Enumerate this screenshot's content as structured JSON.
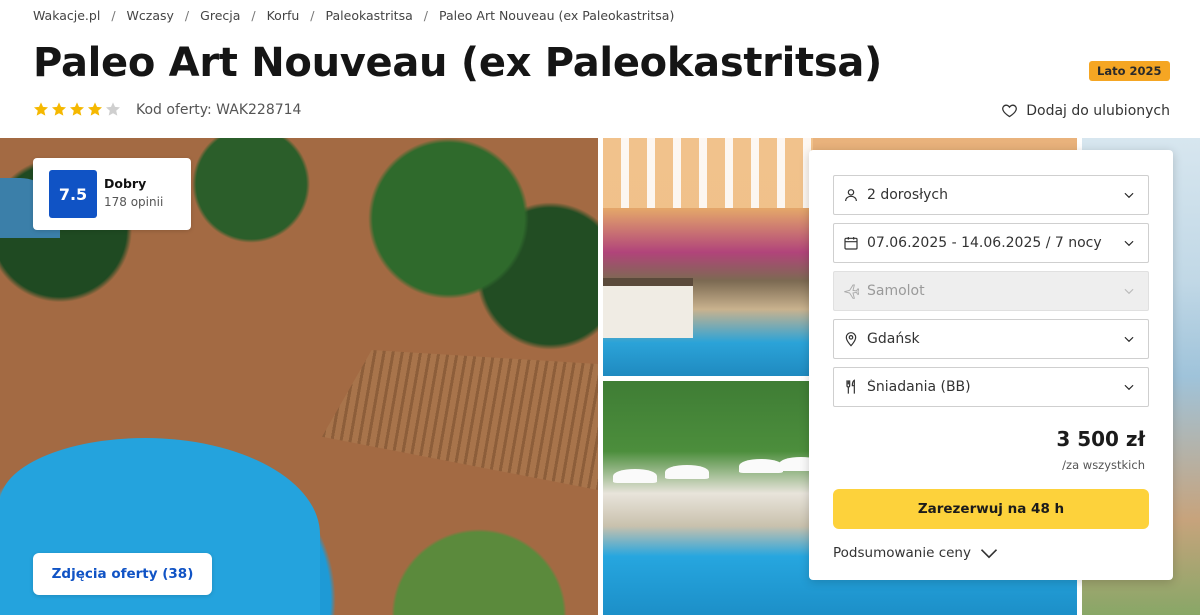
{
  "breadcrumb": [
    "Wakacje.pl",
    "Wczasy",
    "Grecja",
    "Korfu",
    "Paleokastritsa",
    "Paleo Art Nouveau (ex Paleokastritsa)"
  ],
  "title": "Paleo Art Nouveau (ex Paleokastritsa)",
  "season_badge": "Lato 2025",
  "stars": {
    "filled": 4,
    "total": 5
  },
  "offer_code": "Kod oferty: WAK228714",
  "favorite_label": "Dodaj do ulubionych",
  "rating": {
    "score": "7.5",
    "word": "Dobry",
    "count": "178 opinii"
  },
  "photos_button": "Zdjęcia oferty (38)",
  "booking": {
    "guests": "2 dorosłych",
    "dates": "07.06.2025 - 14.06.2025 / 7 nocy",
    "transport": "Samolot",
    "departure": "Gdańsk",
    "board": "Śniadania (BB)",
    "price": "3 500 zł",
    "price_note": "/za wszystkich",
    "reserve_label": "Zarezerwuj na 48 h",
    "summary_label": "Podsumowanie ceny"
  },
  "colors": {
    "accent_blue": "#1053c5",
    "cta_yellow": "#fdd23b",
    "badge_orange": "#f5a623",
    "star_yellow": "#f5b800"
  }
}
